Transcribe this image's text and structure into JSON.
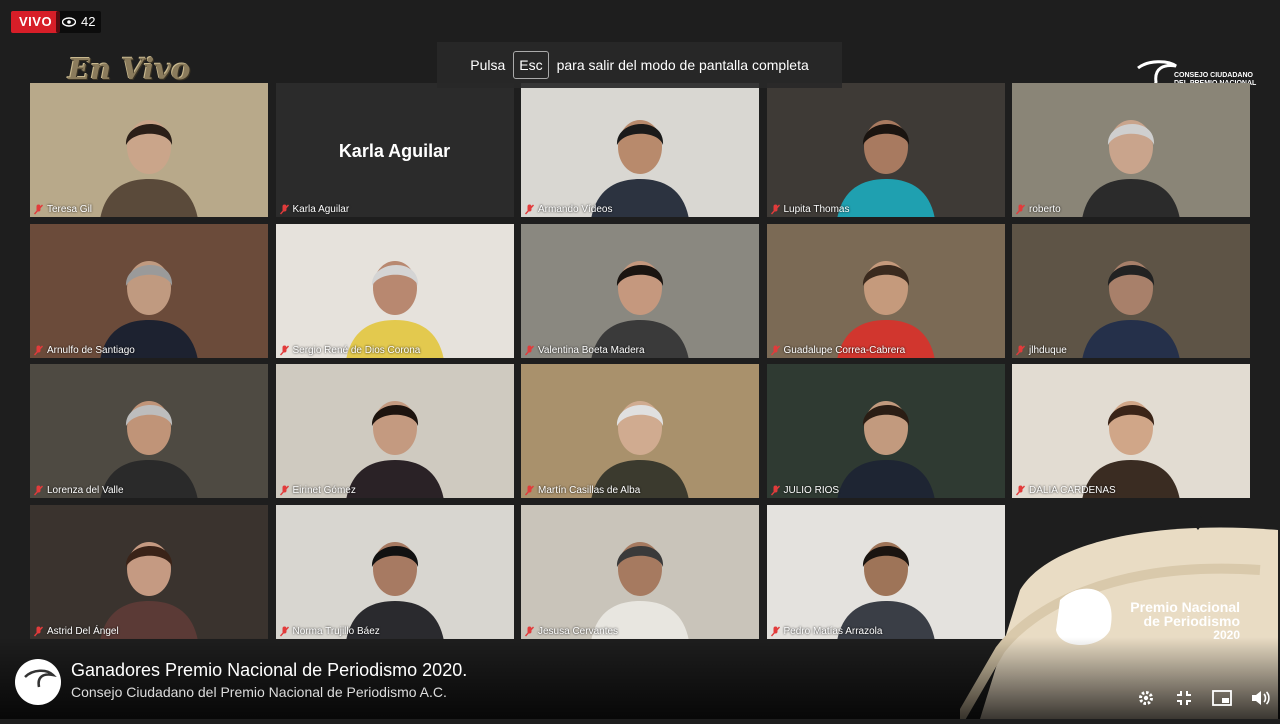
{
  "live": {
    "label": "VIVO",
    "viewers": "42"
  },
  "overlay_text": "En Vivo",
  "fullscreen_tip": {
    "before": "Pulsa",
    "key": "Esc",
    "after": "para salir del modo de pantalla completa"
  },
  "org_logo": {
    "lines": [
      "CONSEJO CIUDADANO",
      "DEL PREMIO NACIONAL",
      "DE PERIODISMO A.C."
    ]
  },
  "participants": [
    {
      "name": "Teresa Gil",
      "bg": "#b8a98a",
      "shirt": "#5a4a3a",
      "skin": "#caa58a",
      "hair": "#2b1f18"
    },
    {
      "name": "Karla Aguilar",
      "placeholder": true
    },
    {
      "name": "Armando Vídeos",
      "bg": "#d9d7d2",
      "shirt": "#2c3340",
      "skin": "#b88a6c",
      "hair": "#1a1a1a",
      "active": true
    },
    {
      "name": "Lupita Thomas",
      "bg": "#3e3a36",
      "shirt": "#1fa0b0",
      "skin": "#a87a60",
      "hair": "#1a1410"
    },
    {
      "name": "roberto",
      "bg": "#8a8577",
      "shirt": "#2b2b2b",
      "skin": "#c9a48c",
      "hair": "#cfcfcf"
    },
    {
      "name": "Arnulfo de Santiago",
      "bg": "#6b4b3a",
      "shirt": "#1d2230",
      "skin": "#c09a80",
      "hair": "#9a9a9a"
    },
    {
      "name": "Sergio René de Dios Corona",
      "bg": "#e6e2dc",
      "shirt": "#e3c94e",
      "skin": "#b88870",
      "hair": "#d4d4d4"
    },
    {
      "name": "Valentina Boeta Madera",
      "bg": "#8a8880",
      "shirt": "#3a3a3a",
      "skin": "#c5987e",
      "hair": "#1a1410"
    },
    {
      "name": "Guadalupe Correa-Cabrera",
      "bg": "#7b6a55",
      "shirt": "#d1362e",
      "skin": "#c59a7c",
      "hair": "#3a2a1e"
    },
    {
      "name": "jlhduque",
      "bg": "#5e5446",
      "shirt": "#25304a",
      "skin": "#a8806a",
      "hair": "#222"
    },
    {
      "name": "Lorenza del Valle",
      "bg": "#4e4a42",
      "shirt": "#2a2a2a",
      "skin": "#c09478",
      "hair": "#bdbdbd"
    },
    {
      "name": "Eirinet Gómez",
      "bg": "#cfcac0",
      "shirt": "#2a2226",
      "skin": "#c49a80",
      "hair": "#1c130e"
    },
    {
      "name": "Martín Casillas de Alba",
      "bg": "#a9916c",
      "shirt": "#3b3a2e",
      "skin": "#d0ab90",
      "hair": "#e0e0e0"
    },
    {
      "name": "JULIO RIOS",
      "bg": "#2f3a32",
      "shirt": "#1e2533",
      "skin": "#c29a7e",
      "hair": "#2a1d14"
    },
    {
      "name": "DALIA CARDENAS",
      "bg": "#e2dcd2",
      "shirt": "#3a2c22",
      "skin": "#d0a688",
      "hair": "#3a2418"
    },
    {
      "name": "Astrid Del Ángel",
      "bg": "#3a332e",
      "shirt": "#5b3a36",
      "skin": "#c59a82",
      "hair": "#3a2318"
    },
    {
      "name": "Norma Trujillo Báez",
      "bg": "#d8d6d0",
      "shirt": "#2a2a2e",
      "skin": "#a77a62",
      "hair": "#111"
    },
    {
      "name": "Jesusa Cervantes",
      "bg": "#c9c4ba",
      "shirt": "#e8e6e0",
      "skin": "#a67a60",
      "hair": "#3a3a3a"
    },
    {
      "name": "Pedro Matías Arrazola",
      "bg": "#e4e2de",
      "shirt": "#3a3e46",
      "skin": "#9e7458",
      "hair": "#1a1410"
    }
  ],
  "brand": {
    "line1": "Premio Nacional",
    "line2": "de  Periodismo",
    "year": "2020"
  },
  "stream": {
    "title": "Ganadores Premio Nacional de Periodismo 2020.",
    "channel": "Consejo Ciudadano del Premio Nacional de Periodismo A.C."
  }
}
